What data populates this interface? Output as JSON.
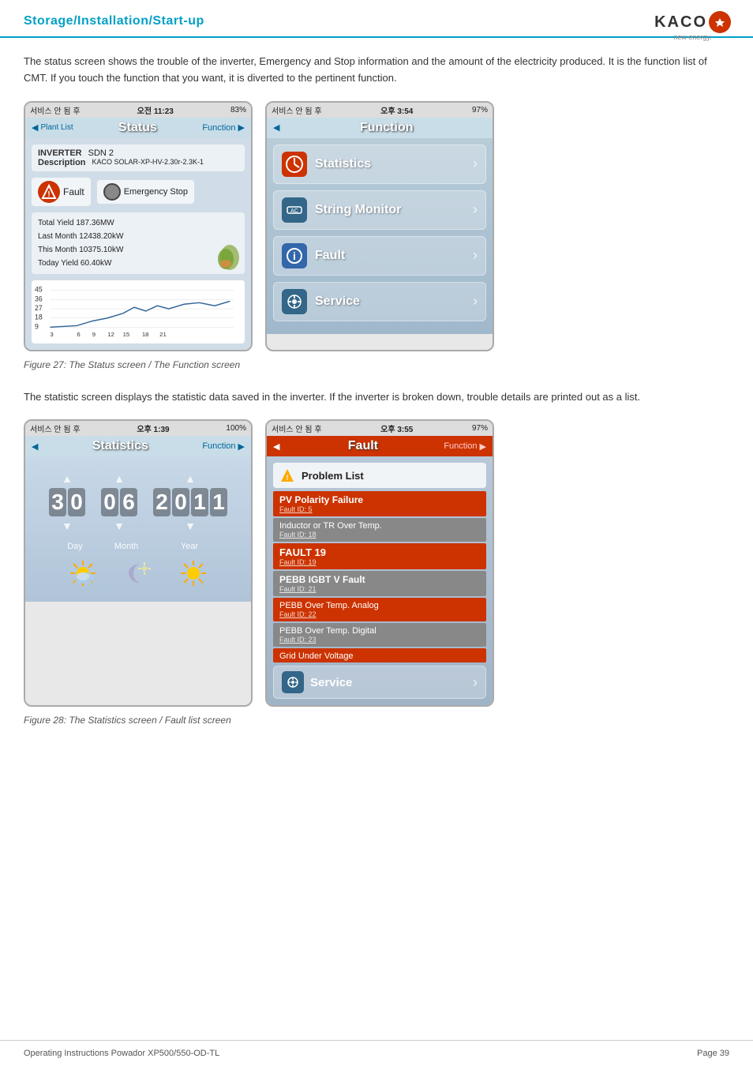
{
  "header": {
    "title": "Storage/Installation/Start-up",
    "logo": "KACO",
    "logo_subtitle": "new energy."
  },
  "section1": {
    "description": "The status screen shows the trouble of the inverter, Emergency and Stop information and the amount of the electricity produced. It is the function list of CMT. If you touch the function that you want, it is diverted to the pertinent function."
  },
  "phone1_status": {
    "signal": "서비스 안 됨 후",
    "time": "오전 11:23",
    "battery": "83%",
    "nav_back": "Plant List",
    "nav_title": "Status",
    "nav_forward": "Function",
    "inverter_label": "INVERTER",
    "inverter_value": "SDN 2",
    "description_label": "Description",
    "description_value": "KACO SOLAR-XP-HV-2.30r-2.3K-1",
    "fault_label": "Fault",
    "emergency_label": "Emergency Stop",
    "total_yield": "Total Yield 187.36MW",
    "last_month": "Last Month 12438.20kW",
    "this_month": "This Month 10375.10kW",
    "today": "Today Yield 60.40kW"
  },
  "phone2_function": {
    "signal": "서비스 안 됨 후",
    "time": "오후 3:54",
    "battery": "97%",
    "nav_back": "",
    "nav_title": "Function",
    "items": [
      {
        "label": "Statistics",
        "color": "#cc3300"
      },
      {
        "label": "String Monitor",
        "color": "#336699"
      },
      {
        "label": "Fault",
        "color": "#336699"
      },
      {
        "label": "Service",
        "color": "#336699"
      }
    ]
  },
  "figure1_caption": "Figure 27:   The Status screen / The Function screen",
  "section2": {
    "description": "The statistic screen displays the statistic data saved in the inverter. If the inverter is broken down, trouble details are printed out as a list."
  },
  "phone3_statistics": {
    "signal": "서비스 안 됨 후",
    "time": "오후 1:39",
    "battery": "100%",
    "nav_back": "",
    "nav_title": "Statistics",
    "nav_forward": "Function",
    "day": "30",
    "month": "06",
    "year": "2011",
    "day_label": "Day",
    "month_label": "Month",
    "year_label": "Year"
  },
  "phone4_fault": {
    "signal": "서비스 안 됨 후",
    "time": "오후 3:55",
    "battery": "97%",
    "nav_back": "",
    "nav_title": "Fault",
    "nav_forward": "Function",
    "problem_list": "Problem List",
    "faults": [
      {
        "name": "PV Polarity Failure",
        "id": "Fault ID: 5"
      },
      {
        "name": "Inductor or TR Over Temp.",
        "id": "Fault ID: 18"
      },
      {
        "name": "FAULT 19",
        "id": "Fault ID: 19"
      },
      {
        "name": "PEBB IGBT V Fault",
        "id": "Fault ID: 21"
      },
      {
        "name": "PEBB Over Temp. Analog",
        "id": "Fault ID: 22"
      },
      {
        "name": "PEBB Over Temp. Digital",
        "id": "Fault ID: 23"
      },
      {
        "name": "Grid Under Voltage",
        "id": ""
      }
    ],
    "service_label": "Service"
  },
  "figure2_caption": "Figure 28:   The Statistics screen / Fault list screen",
  "footer": {
    "left": "Operating Instructions Powador XP500/550-OD-TL",
    "right": "Page 39"
  }
}
